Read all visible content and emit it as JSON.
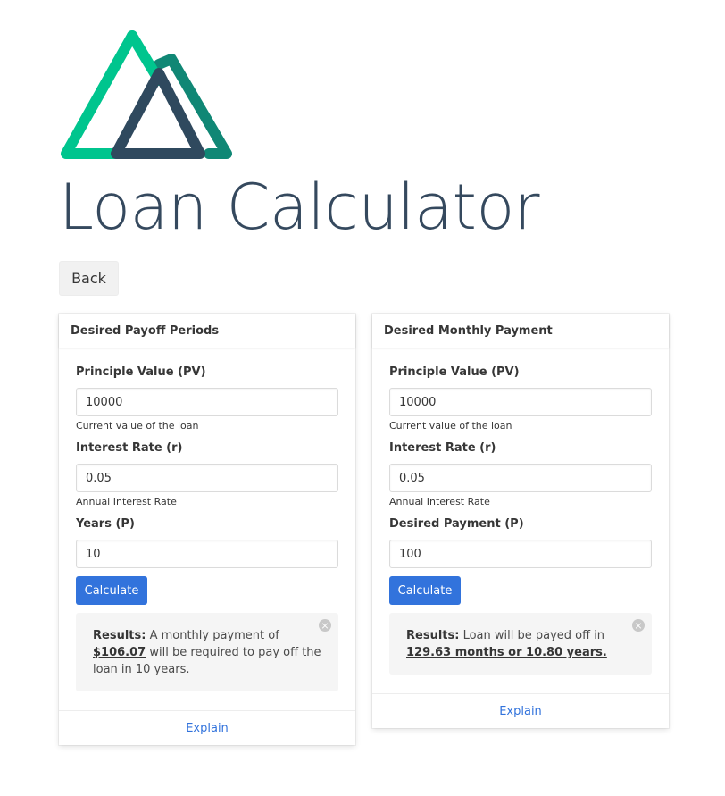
{
  "page": {
    "title": "Loan Calculator",
    "back_label": "Back",
    "colors": {
      "logo_green": "#00c58e",
      "logo_dark": "#2f495e",
      "logo_teal": "#108775",
      "title": "#35495e",
      "primary": "#3273dc"
    }
  },
  "payoff_card": {
    "header": "Desired Payoff Periods",
    "pv_label": "Principle Value (PV)",
    "pv_value": "10000",
    "pv_help": "Current value of the loan",
    "rate_label": "Interest Rate (r)",
    "rate_value": "0.05",
    "rate_help": "Annual Interest Rate",
    "years_label": "Years (P)",
    "years_value": "10",
    "calculate_label": "Calculate",
    "result_label": "Results:",
    "result_text_1": " A monthly payment of ",
    "result_amount": "$106.07",
    "result_text_2": " will be required to pay off the loan in 10 years.",
    "explain_label": "Explain"
  },
  "monthly_card": {
    "header": "Desired Monthly Payment",
    "pv_label": "Principle Value (PV)",
    "pv_value": "10000",
    "pv_help": "Current value of the loan",
    "rate_label": "Interest Rate (r)",
    "rate_value": "0.05",
    "rate_help": "Annual Interest Rate",
    "payment_label": "Desired Payment (P)",
    "payment_value": "100",
    "calculate_label": "Calculate",
    "result_label": "Results:",
    "result_text_1": " Loan will be payed off in ",
    "result_amount": "129.63 months or 10.80 years.",
    "explain_label": "Explain"
  }
}
